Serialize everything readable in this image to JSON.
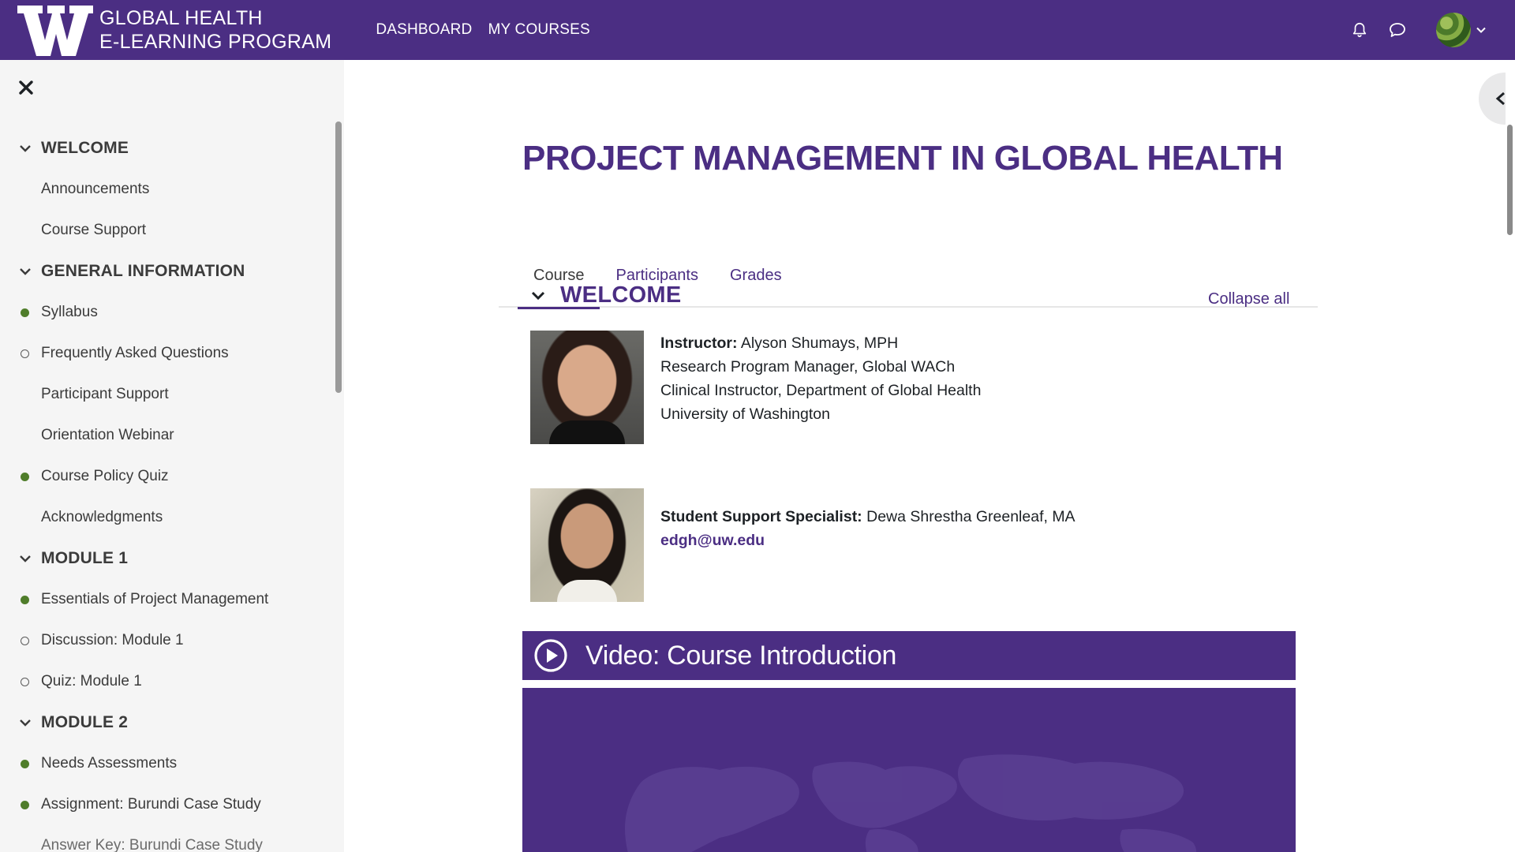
{
  "navbar": {
    "brand_line1": "GLOBAL HEALTH",
    "brand_line2": "E-LEARNING PROGRAM",
    "links": [
      "DASHBOARD",
      "MY COURSES"
    ],
    "icons": [
      "bell-icon",
      "chat-icon",
      "user-avatar",
      "chevron-down-icon"
    ],
    "brand_color": "#4b2e83"
  },
  "sidebar": {
    "sections": [
      {
        "title": "WELCOME",
        "items": [
          {
            "label": "Announcements",
            "status": "none"
          },
          {
            "label": "Course Support",
            "status": "none"
          }
        ]
      },
      {
        "title": "GENERAL INFORMATION",
        "items": [
          {
            "label": "Syllabus",
            "status": "complete"
          },
          {
            "label": "Frequently Asked Questions",
            "status": "incomplete"
          },
          {
            "label": "Participant Support",
            "status": "none"
          },
          {
            "label": "Orientation Webinar",
            "status": "none"
          },
          {
            "label": "Course Policy Quiz",
            "status": "complete"
          },
          {
            "label": "Acknowledgments",
            "status": "none"
          }
        ]
      },
      {
        "title": "MODULE 1",
        "items": [
          {
            "label": "Essentials of Project Management",
            "status": "complete"
          },
          {
            "label": "Discussion: Module 1",
            "status": "incomplete"
          },
          {
            "label": "Quiz: Module 1",
            "status": "incomplete"
          }
        ]
      },
      {
        "title": "MODULE 2",
        "items": [
          {
            "label": "Needs Assessments",
            "status": "complete"
          },
          {
            "label": "Assignment: Burundi Case Study",
            "status": "complete"
          },
          {
            "label": "Answer Key: Burundi Case Study",
            "status": "none"
          }
        ]
      }
    ],
    "status_colors": {
      "complete": "#4f7d2a",
      "incomplete": "#5a5a5a"
    }
  },
  "course": {
    "title": "PROJECT MANAGEMENT IN GLOBAL HEALTH",
    "tabs": [
      "Course",
      "Participants",
      "Grades"
    ],
    "active_tab": "Course",
    "section_title": "WELCOME",
    "collapse_all": "Collapse all",
    "instructor": {
      "label": "Instructor:",
      "name": "Alyson Shumays, MPH",
      "lines": [
        "Research Program Manager, Global WACh",
        "Clinical Instructor, Department of Global Health",
        "University of Washington"
      ]
    },
    "support": {
      "label": "Student Support Specialist:",
      "name": "Dewa Shrestha Greenleaf, MA",
      "email": "edgh@uw.edu"
    },
    "video": {
      "title": "Video: Course Introduction"
    }
  }
}
